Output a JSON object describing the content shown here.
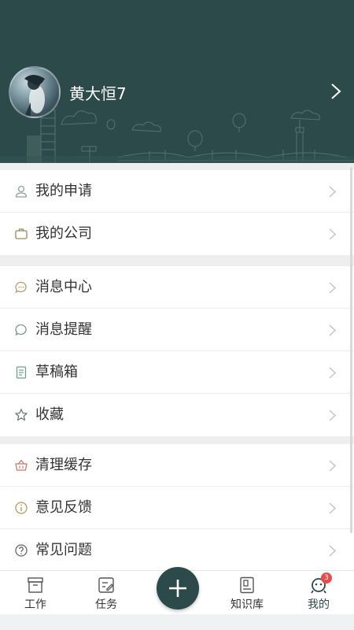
{
  "profile": {
    "username": "黄大恒7",
    "avatar": "avatar-image",
    "chevron_icon": "chevron-right-icon"
  },
  "menu": {
    "groups": [
      {
        "items": [
          {
            "label": "我的申请",
            "icon": "user-icon"
          },
          {
            "label": "我的公司",
            "icon": "briefcase-icon"
          }
        ]
      },
      {
        "items": [
          {
            "label": "消息中心",
            "icon": "message-center-icon"
          },
          {
            "label": "消息提醒",
            "icon": "chat-bubble-icon"
          },
          {
            "label": "草稿箱",
            "icon": "draft-icon"
          },
          {
            "label": "收藏",
            "icon": "star-icon"
          }
        ]
      },
      {
        "items": [
          {
            "label": "清理缓存",
            "icon": "basket-icon"
          },
          {
            "label": "意见反馈",
            "icon": "info-icon"
          },
          {
            "label": "常见问题",
            "icon": "question-icon"
          }
        ]
      }
    ]
  },
  "tabbar": {
    "tabs": [
      {
        "label": "工作",
        "icon": "inbox-icon"
      },
      {
        "label": "任务",
        "icon": "edit-icon"
      },
      {
        "label": "知识库",
        "icon": "book-icon"
      },
      {
        "label": "我的",
        "icon": "face-icon"
      }
    ],
    "fab_icon": "plus-icon",
    "badge_count": "3"
  },
  "colors": {
    "header_bg": "#2c4a4a",
    "accent": "#2b4a49",
    "badge": "#e94b4b"
  }
}
